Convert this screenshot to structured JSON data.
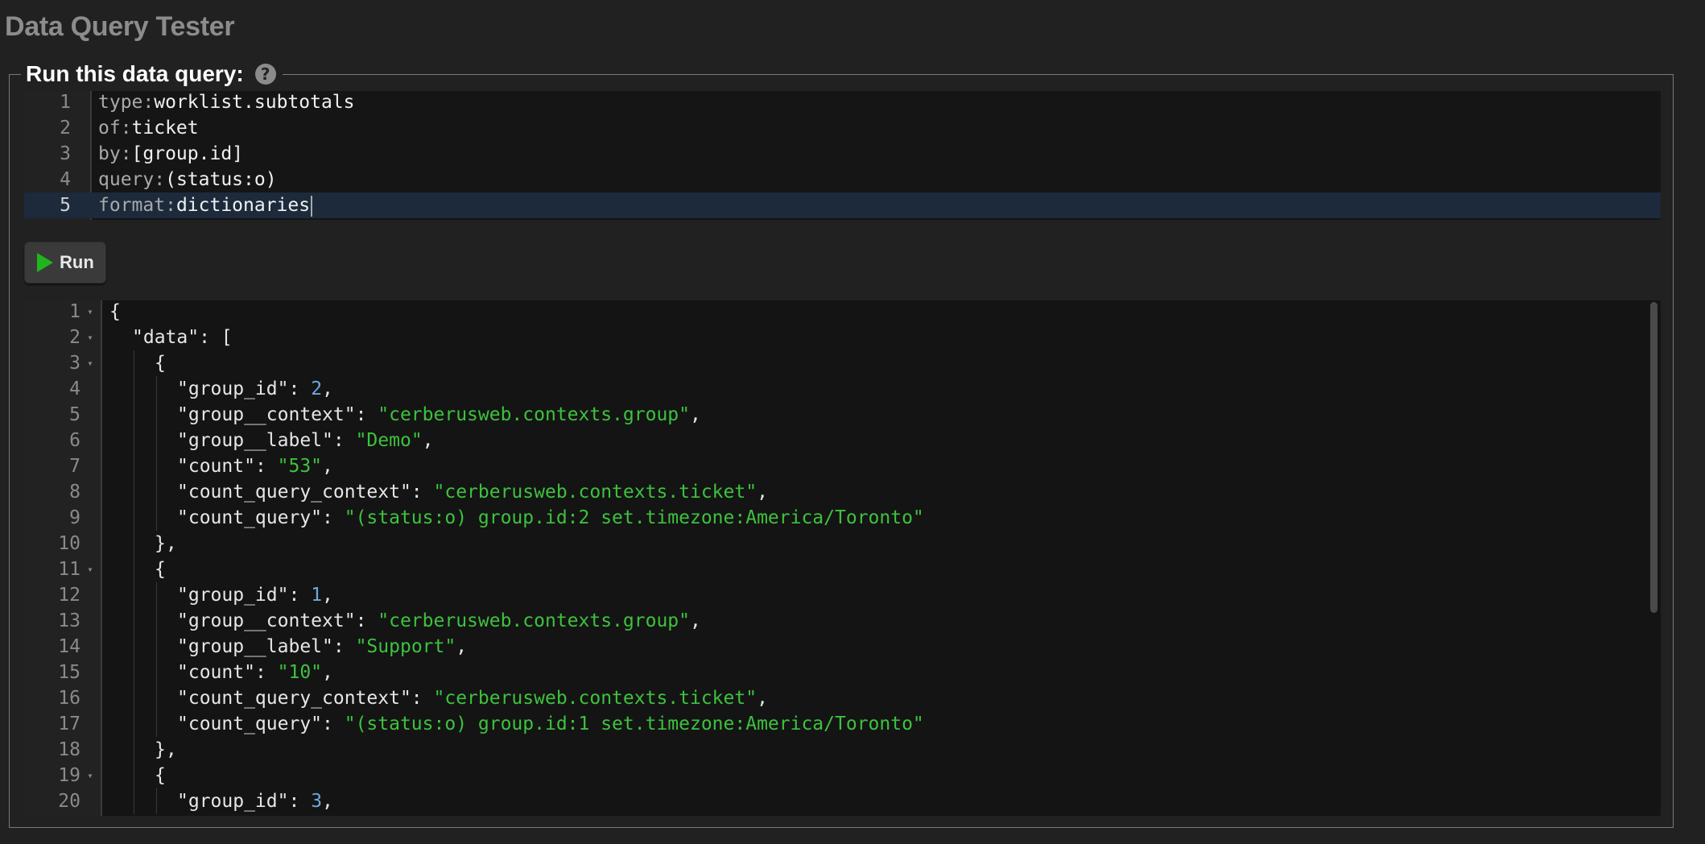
{
  "page": {
    "title": "Data Query Tester"
  },
  "panel": {
    "legend": "Run this data query:",
    "help_icon": "question-circle-icon"
  },
  "query_editor": {
    "lines": [
      {
        "num": "1",
        "key": "type:",
        "value": "worklist.subtotals"
      },
      {
        "num": "2",
        "key": "of:",
        "value": "ticket"
      },
      {
        "num": "3",
        "key": "by:",
        "value": "[group.id]"
      },
      {
        "num": "4",
        "key": "query:",
        "value": "(status:o)"
      },
      {
        "num": "5",
        "key": "format:",
        "value": "dictionaries"
      }
    ]
  },
  "run_button": {
    "label": "Run",
    "icon": "play-icon",
    "icon_color": "#1fb51f"
  },
  "result_editor": {
    "lines": [
      {
        "num": "1",
        "fold": true,
        "indent": 0,
        "parts": [
          [
            "p",
            "{"
          ]
        ]
      },
      {
        "num": "2",
        "fold": true,
        "indent": 1,
        "parts": [
          [
            "k",
            "\"data\""
          ],
          [
            "p",
            ": ["
          ]
        ]
      },
      {
        "num": "3",
        "fold": true,
        "indent": 2,
        "parts": [
          [
            "p",
            "{"
          ]
        ]
      },
      {
        "num": "4",
        "fold": false,
        "indent": 3,
        "parts": [
          [
            "k",
            "\"group_id\""
          ],
          [
            "p",
            ": "
          ],
          [
            "n",
            "2"
          ],
          [
            "p",
            ","
          ]
        ]
      },
      {
        "num": "5",
        "fold": false,
        "indent": 3,
        "parts": [
          [
            "k",
            "\"group__context\""
          ],
          [
            "p",
            ": "
          ],
          [
            "s",
            "\"cerberusweb.contexts.group\""
          ],
          [
            "p",
            ","
          ]
        ]
      },
      {
        "num": "6",
        "fold": false,
        "indent": 3,
        "parts": [
          [
            "k",
            "\"group__label\""
          ],
          [
            "p",
            ": "
          ],
          [
            "s",
            "\"Demo\""
          ],
          [
            "p",
            ","
          ]
        ]
      },
      {
        "num": "7",
        "fold": false,
        "indent": 3,
        "parts": [
          [
            "k",
            "\"count\""
          ],
          [
            "p",
            ": "
          ],
          [
            "s",
            "\"53\""
          ],
          [
            "p",
            ","
          ]
        ]
      },
      {
        "num": "8",
        "fold": false,
        "indent": 3,
        "parts": [
          [
            "k",
            "\"count_query_context\""
          ],
          [
            "p",
            ": "
          ],
          [
            "s",
            "\"cerberusweb.contexts.ticket\""
          ],
          [
            "p",
            ","
          ]
        ]
      },
      {
        "num": "9",
        "fold": false,
        "indent": 3,
        "parts": [
          [
            "k",
            "\"count_query\""
          ],
          [
            "p",
            ": "
          ],
          [
            "s",
            "\"(status:o) group.id:2 set.timezone:America/Toronto\""
          ]
        ]
      },
      {
        "num": "10",
        "fold": false,
        "indent": 2,
        "parts": [
          [
            "p",
            "},"
          ]
        ]
      },
      {
        "num": "11",
        "fold": true,
        "indent": 2,
        "parts": [
          [
            "p",
            "{"
          ]
        ]
      },
      {
        "num": "12",
        "fold": false,
        "indent": 3,
        "parts": [
          [
            "k",
            "\"group_id\""
          ],
          [
            "p",
            ": "
          ],
          [
            "n",
            "1"
          ],
          [
            "p",
            ","
          ]
        ]
      },
      {
        "num": "13",
        "fold": false,
        "indent": 3,
        "parts": [
          [
            "k",
            "\"group__context\""
          ],
          [
            "p",
            ": "
          ],
          [
            "s",
            "\"cerberusweb.contexts.group\""
          ],
          [
            "p",
            ","
          ]
        ]
      },
      {
        "num": "14",
        "fold": false,
        "indent": 3,
        "parts": [
          [
            "k",
            "\"group__label\""
          ],
          [
            "p",
            ": "
          ],
          [
            "s",
            "\"Support\""
          ],
          [
            "p",
            ","
          ]
        ]
      },
      {
        "num": "15",
        "fold": false,
        "indent": 3,
        "parts": [
          [
            "k",
            "\"count\""
          ],
          [
            "p",
            ": "
          ],
          [
            "s",
            "\"10\""
          ],
          [
            "p",
            ","
          ]
        ]
      },
      {
        "num": "16",
        "fold": false,
        "indent": 3,
        "parts": [
          [
            "k",
            "\"count_query_context\""
          ],
          [
            "p",
            ": "
          ],
          [
            "s",
            "\"cerberusweb.contexts.ticket\""
          ],
          [
            "p",
            ","
          ]
        ]
      },
      {
        "num": "17",
        "fold": false,
        "indent": 3,
        "parts": [
          [
            "k",
            "\"count_query\""
          ],
          [
            "p",
            ": "
          ],
          [
            "s",
            "\"(status:o) group.id:1 set.timezone:America/Toronto\""
          ]
        ]
      },
      {
        "num": "18",
        "fold": false,
        "indent": 2,
        "parts": [
          [
            "p",
            "},"
          ]
        ]
      },
      {
        "num": "19",
        "fold": true,
        "indent": 2,
        "parts": [
          [
            "p",
            "{"
          ]
        ]
      },
      {
        "num": "20",
        "fold": false,
        "indent": 3,
        "parts": [
          [
            "k",
            "\"group_id\""
          ],
          [
            "p",
            ": "
          ],
          [
            "n",
            "3"
          ],
          [
            "p",
            ","
          ]
        ]
      }
    ]
  }
}
